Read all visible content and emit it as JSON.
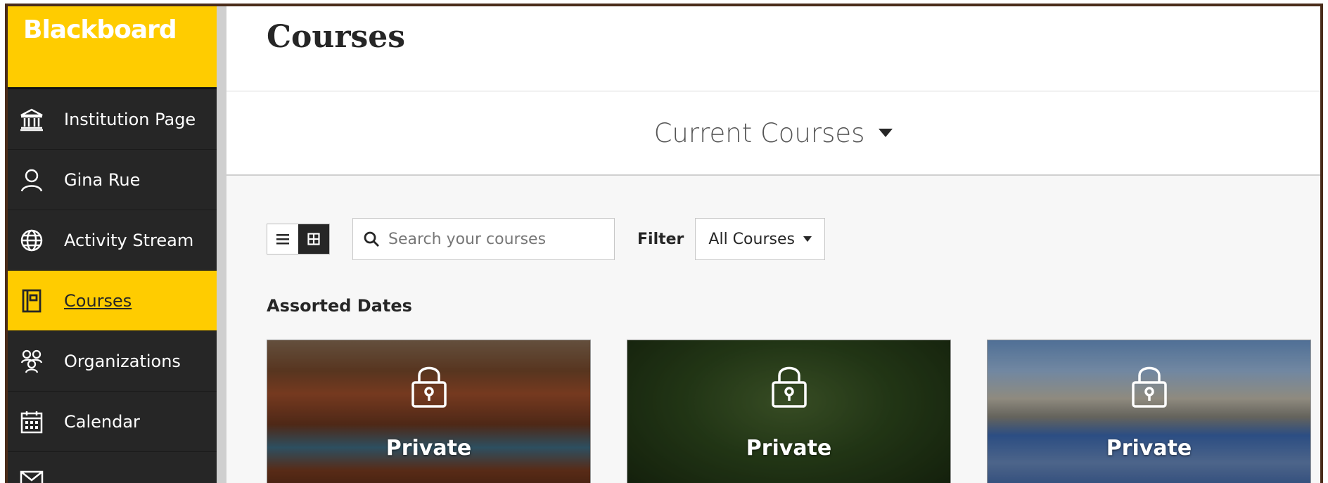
{
  "brand": {
    "name": "Blackboard"
  },
  "sidebar": {
    "items": [
      {
        "label": "Institution Page",
        "icon": "institution-icon"
      },
      {
        "label": "Gina Rue",
        "icon": "user-icon"
      },
      {
        "label": "Activity Stream",
        "icon": "globe-icon"
      },
      {
        "label": "Courses",
        "icon": "courses-icon",
        "active": true
      },
      {
        "label": "Organizations",
        "icon": "organizations-icon"
      },
      {
        "label": "Calendar",
        "icon": "calendar-icon"
      },
      {
        "label": "",
        "icon": "messages-icon"
      }
    ]
  },
  "page": {
    "title": "Courses",
    "term_selector": "Current Courses"
  },
  "toolbar": {
    "search_placeholder": "Search your courses",
    "filter_label": "Filter",
    "filter_value": "All Courses"
  },
  "section": {
    "title": "Assorted Dates"
  },
  "cards": [
    {
      "status": "Private",
      "image": "canyon"
    },
    {
      "status": "Private",
      "image": "forest"
    },
    {
      "status": "Private",
      "image": "lake"
    }
  ],
  "colors": {
    "accent": "#ffcc00",
    "sidebar": "#262626",
    "background": "#f7f7f7"
  }
}
